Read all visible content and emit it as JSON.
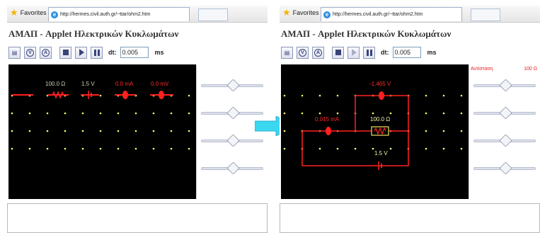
{
  "colors": {
    "accent_arrow": "#3ad8f0",
    "wire_red": "#ff2020",
    "canvas_bg": "#000000",
    "grid_dot": "#ffff66"
  },
  "left": {
    "favorites_label": "Favorites",
    "tab_url": "http://hermes.civil.auth.gr/~ttar/ohm2.htm",
    "page_title": "ΑΜΑΠ - Applet Ηλεκτρικών Κυκλωμάτων",
    "toolbar": {
      "dt_label": "dt:",
      "dt_value": "0.005",
      "ms_label": "ms",
      "v_button": "V",
      "a_button": "A"
    },
    "labels": {
      "resistor": "100.0 Ω",
      "battery": "1.5 V",
      "ammeter": "0.0 mA",
      "voltmeter": "0.0 mV"
    }
  },
  "right": {
    "favorites_label": "Favorites",
    "tab_url": "http://hermes.civil.auth.gr/~ttar/ohm2.htm",
    "page_title": "ΑΜΑΠ - Applet Ηλεκτρικών Κυκλωμάτων",
    "toolbar": {
      "dt_label": "dt:",
      "dt_value": "0.005",
      "ms_label": "ms",
      "v_button": "V",
      "a_button": "A"
    },
    "labels": {
      "voltmeter": "-1.465 V",
      "ammeter": "0.015 mA",
      "resistor": "100.0 Ω",
      "battery": "1.5 V"
    },
    "slider": {
      "label": "Αντίσταση",
      "value": "100 Ω"
    }
  }
}
